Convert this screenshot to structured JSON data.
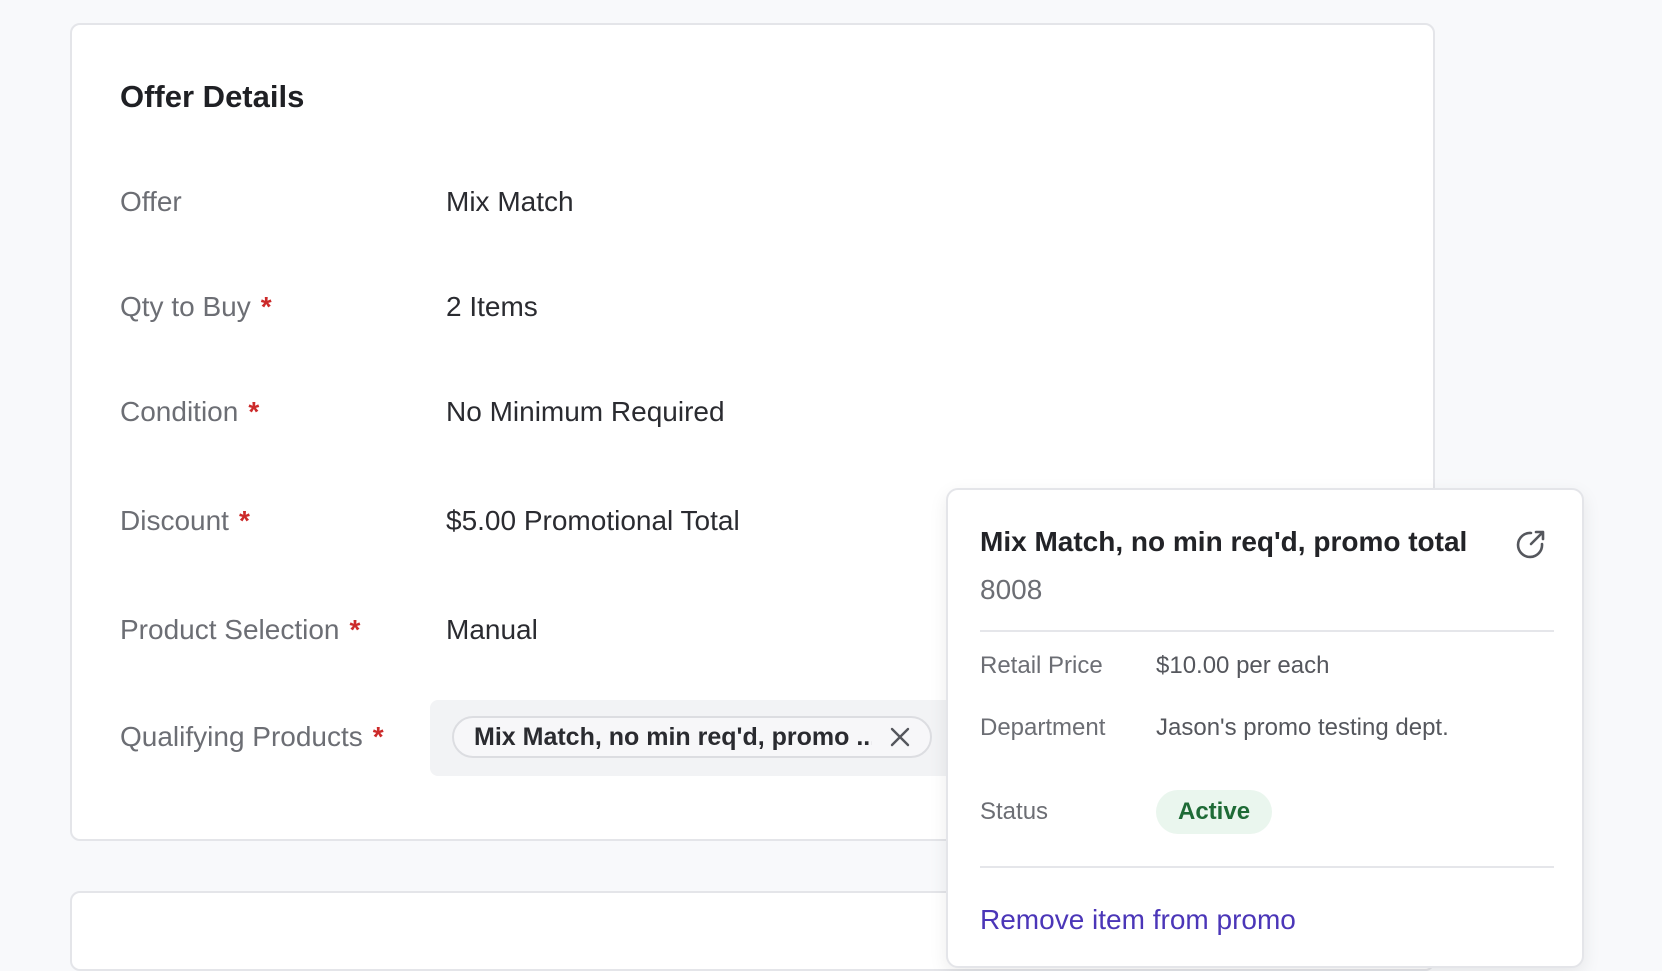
{
  "offer_details": {
    "title": "Offer Details",
    "required_marker": "*",
    "rows": [
      {
        "label": "Offer",
        "value": "Mix Match",
        "required": false
      },
      {
        "label": "Qty to Buy",
        "value": "2 Items",
        "required": true
      },
      {
        "label": "Condition",
        "value": "No Minimum Required",
        "required": true
      },
      {
        "label": "Discount",
        "value": "$5.00 Promotional Total",
        "required": true
      },
      {
        "label": "Product Selection",
        "value": "Manual",
        "required": true
      },
      {
        "label": "Qualifying Products",
        "value": "",
        "required": true
      }
    ],
    "qualifying_chip": {
      "label": "Mix Match, no min req'd, promo ...",
      "remove_icon": "close-icon"
    }
  },
  "popover": {
    "title": "Mix Match, no min req'd, promo total",
    "code": "8008",
    "external_icon": "external-link-icon",
    "fields": [
      {
        "label": "Retail Price",
        "value": "$10.00 per each"
      },
      {
        "label": "Department",
        "value": "Jason's promo testing dept."
      },
      {
        "label": "Status",
        "value": "Active"
      }
    ],
    "status_color": "#1e6b36",
    "remove_link": "Remove item from promo",
    "link_color": "#4b36b8"
  },
  "colors": {
    "required": "#cc2a2a",
    "background": "#f8f9fb"
  }
}
